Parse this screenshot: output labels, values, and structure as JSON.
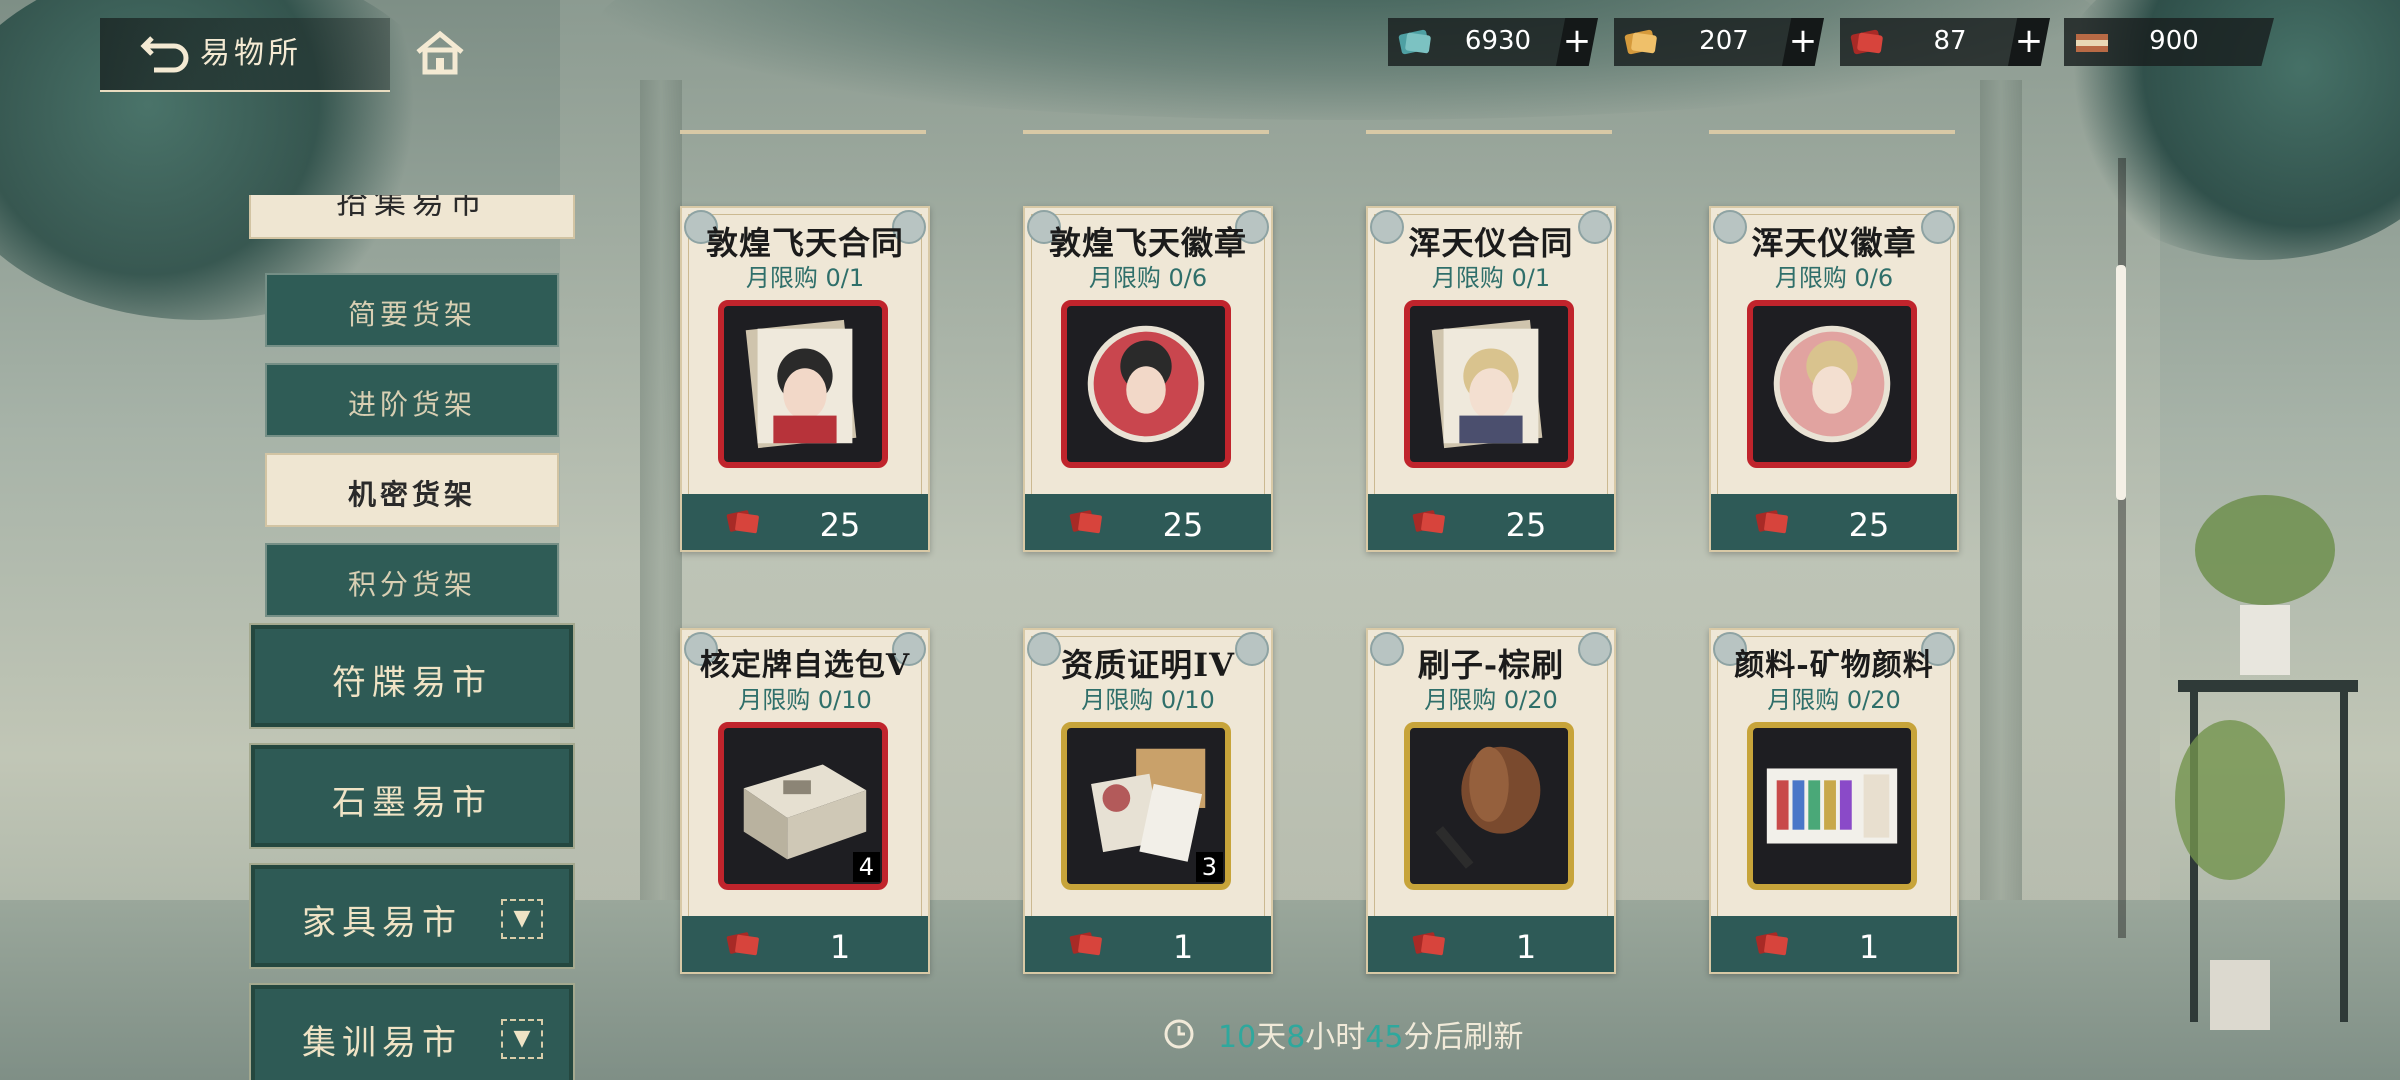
{
  "header": {
    "title": "易物所"
  },
  "currencies": [
    {
      "icon": "teal-ticket-icon",
      "value": "6930",
      "color": "#4ea0a3"
    },
    {
      "icon": "gold-ticket-icon",
      "value": "207",
      "color": "#d59a3c"
    },
    {
      "icon": "red-ticket-icon",
      "value": "87",
      "color": "#c2352f"
    },
    {
      "icon": "scroll-ticket-icon",
      "value": "900",
      "color": "#b86a45"
    }
  ],
  "plus_label": "+",
  "sidebar": {
    "top_partial": "拾集易市",
    "sub_items": [
      "简要货架",
      "进阶货架",
      "机密货架",
      "积分货架"
    ],
    "active_sub": "机密货架",
    "markets": [
      "符牒易市",
      "石墨易市",
      "家具易市",
      "集训易市"
    ],
    "dropdown_glyph": "▼"
  },
  "items": [
    {
      "name": "敦煌飞天合同",
      "limit": "月限购 0/1",
      "price": "25",
      "frame": "red",
      "qty": ""
    },
    {
      "name": "敦煌飞天徽章",
      "limit": "月限购 0/6",
      "price": "25",
      "frame": "red",
      "qty": ""
    },
    {
      "name": "浑天仪合同",
      "limit": "月限购 0/1",
      "price": "25",
      "frame": "red",
      "qty": ""
    },
    {
      "name": "浑天仪徽章",
      "limit": "月限购 0/6",
      "price": "25",
      "frame": "red",
      "qty": ""
    },
    {
      "name": "核定牌自选包V",
      "limit": "月限购 0/10",
      "price": "1",
      "frame": "red",
      "qty": "4"
    },
    {
      "name": "资质证明IV",
      "limit": "月限购 0/10",
      "price": "1",
      "frame": "gold",
      "qty": "3"
    },
    {
      "name": "刷子-棕刷",
      "limit": "月限购 0/20",
      "price": "1",
      "frame": "gold",
      "qty": ""
    },
    {
      "name": "颜料-矿物颜料",
      "limit": "月限购 0/20",
      "price": "1",
      "frame": "gold",
      "qty": ""
    }
  ],
  "refresh": {
    "days": "10",
    "days_unit": "天",
    "hours": "8",
    "hours_unit": "小时",
    "minutes": "45",
    "minutes_suffix": "分后刷新"
  }
}
